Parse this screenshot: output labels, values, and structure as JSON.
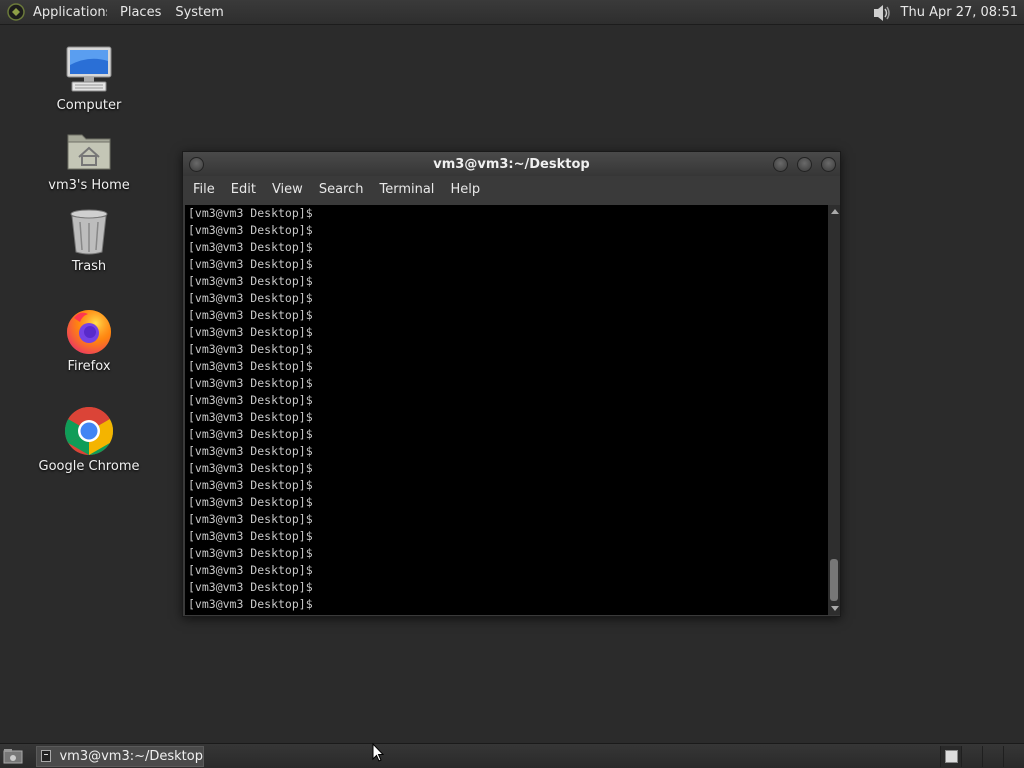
{
  "top_panel": {
    "menus": [
      "Applications",
      "Places",
      "System"
    ],
    "clock": "Thu Apr 27, 08:51"
  },
  "desktop_icons": [
    {
      "label": "Computer",
      "icon": "computer-icon"
    },
    {
      "label": "vm3's Home",
      "icon": "home-folder-icon"
    },
    {
      "label": "Trash",
      "icon": "trash-icon"
    },
    {
      "label": "Firefox",
      "icon": "firefox-icon"
    },
    {
      "label": "Google Chrome",
      "icon": "chrome-icon"
    }
  ],
  "terminal": {
    "title": "vm3@vm3:~/Desktop",
    "menu": [
      "File",
      "Edit",
      "View",
      "Search",
      "Terminal",
      "Help"
    ],
    "prompt": "[vm3@vm3 Desktop]$",
    "line_count": 24
  },
  "taskbar": {
    "tasks": [
      {
        "label": "vm3@vm3:~/Desktop"
      }
    ]
  }
}
